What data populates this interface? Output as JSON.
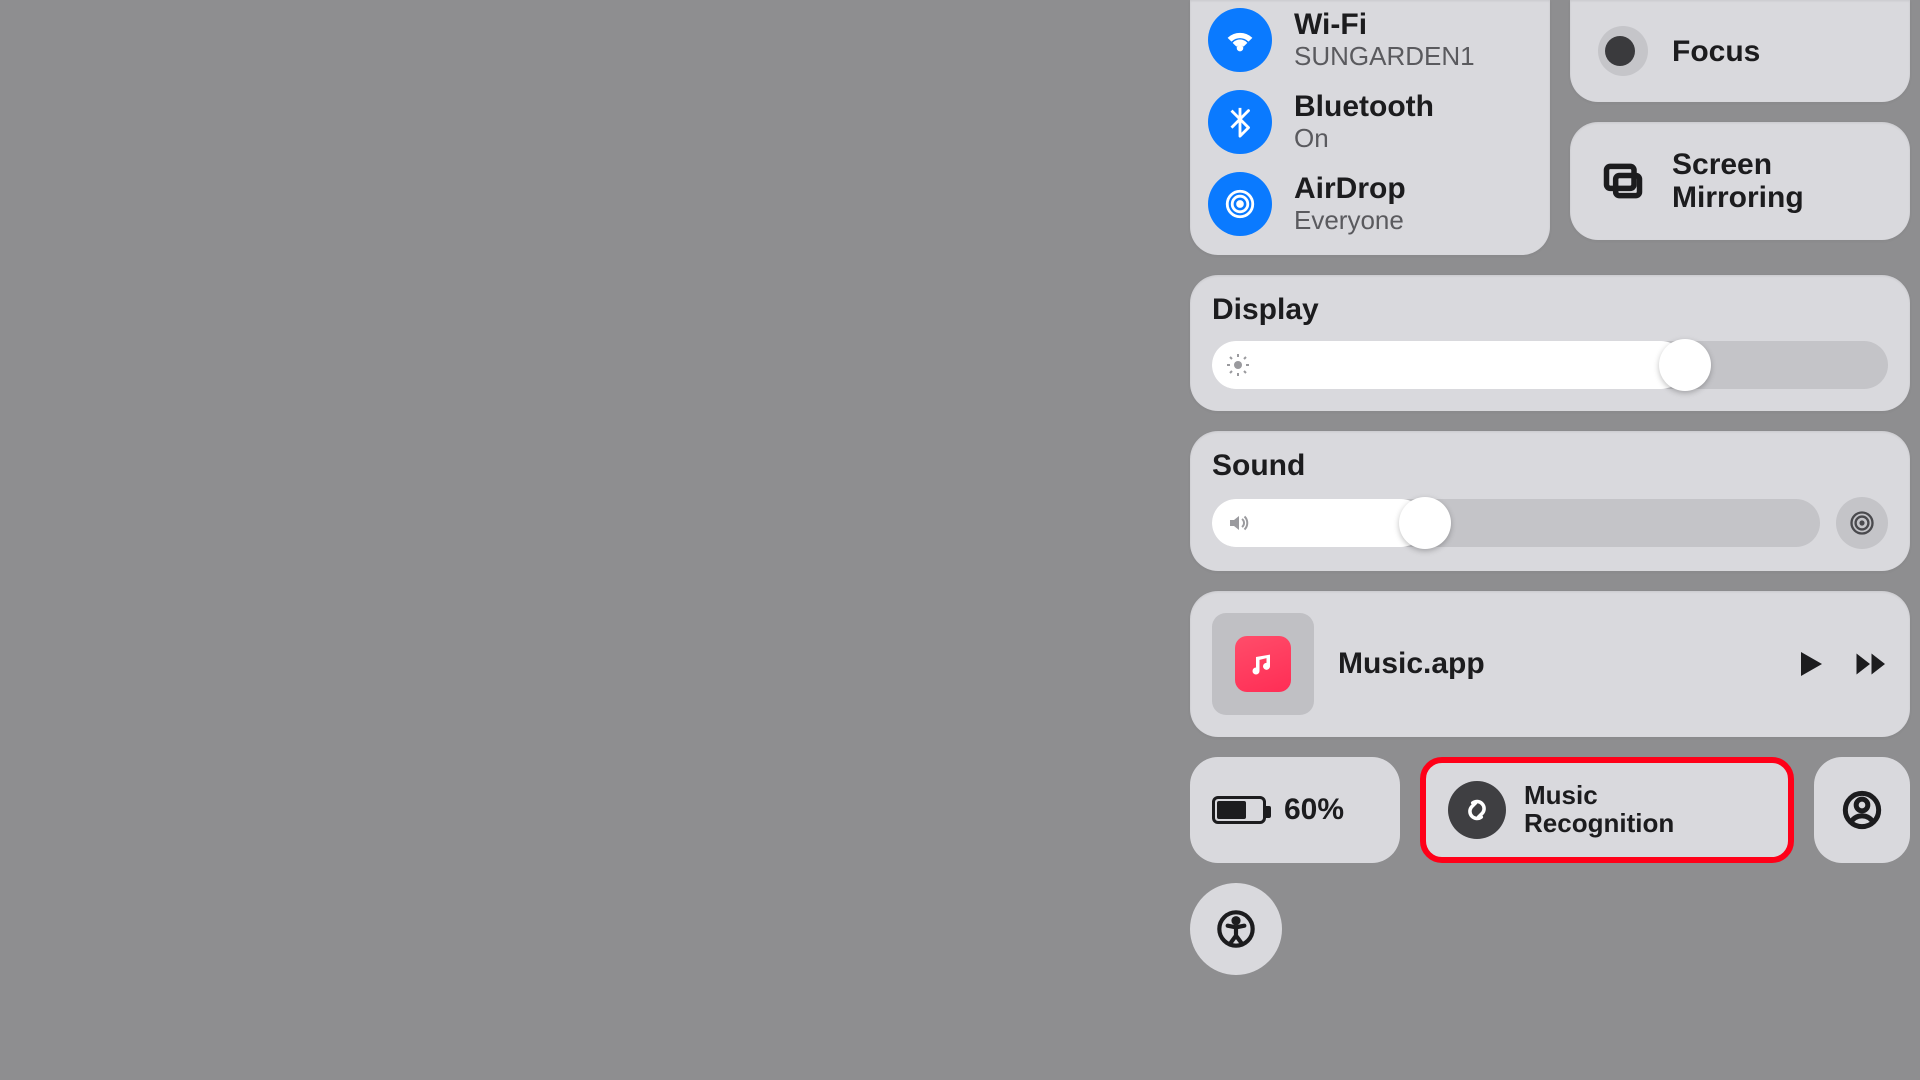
{
  "connectivity": {
    "wifi": {
      "label": "Wi-Fi",
      "status": "SUNGARDEN1"
    },
    "bluetooth": {
      "label": "Bluetooth",
      "status": "On"
    },
    "airdrop": {
      "label": "AirDrop",
      "status": "Everyone"
    }
  },
  "focus": {
    "label": "Focus"
  },
  "screen_mirroring": {
    "label": "Screen Mirroring"
  },
  "display": {
    "label": "Display",
    "brightness_percent": 70
  },
  "sound": {
    "label": "Sound",
    "volume_percent": 35
  },
  "now_playing": {
    "title": "Music.app"
  },
  "battery": {
    "label": "60%",
    "level_percent": 60
  },
  "music_recognition": {
    "label": "Music Recognition"
  },
  "highlight": {
    "target": "music-recognition-button",
    "color": "#ff0018"
  }
}
